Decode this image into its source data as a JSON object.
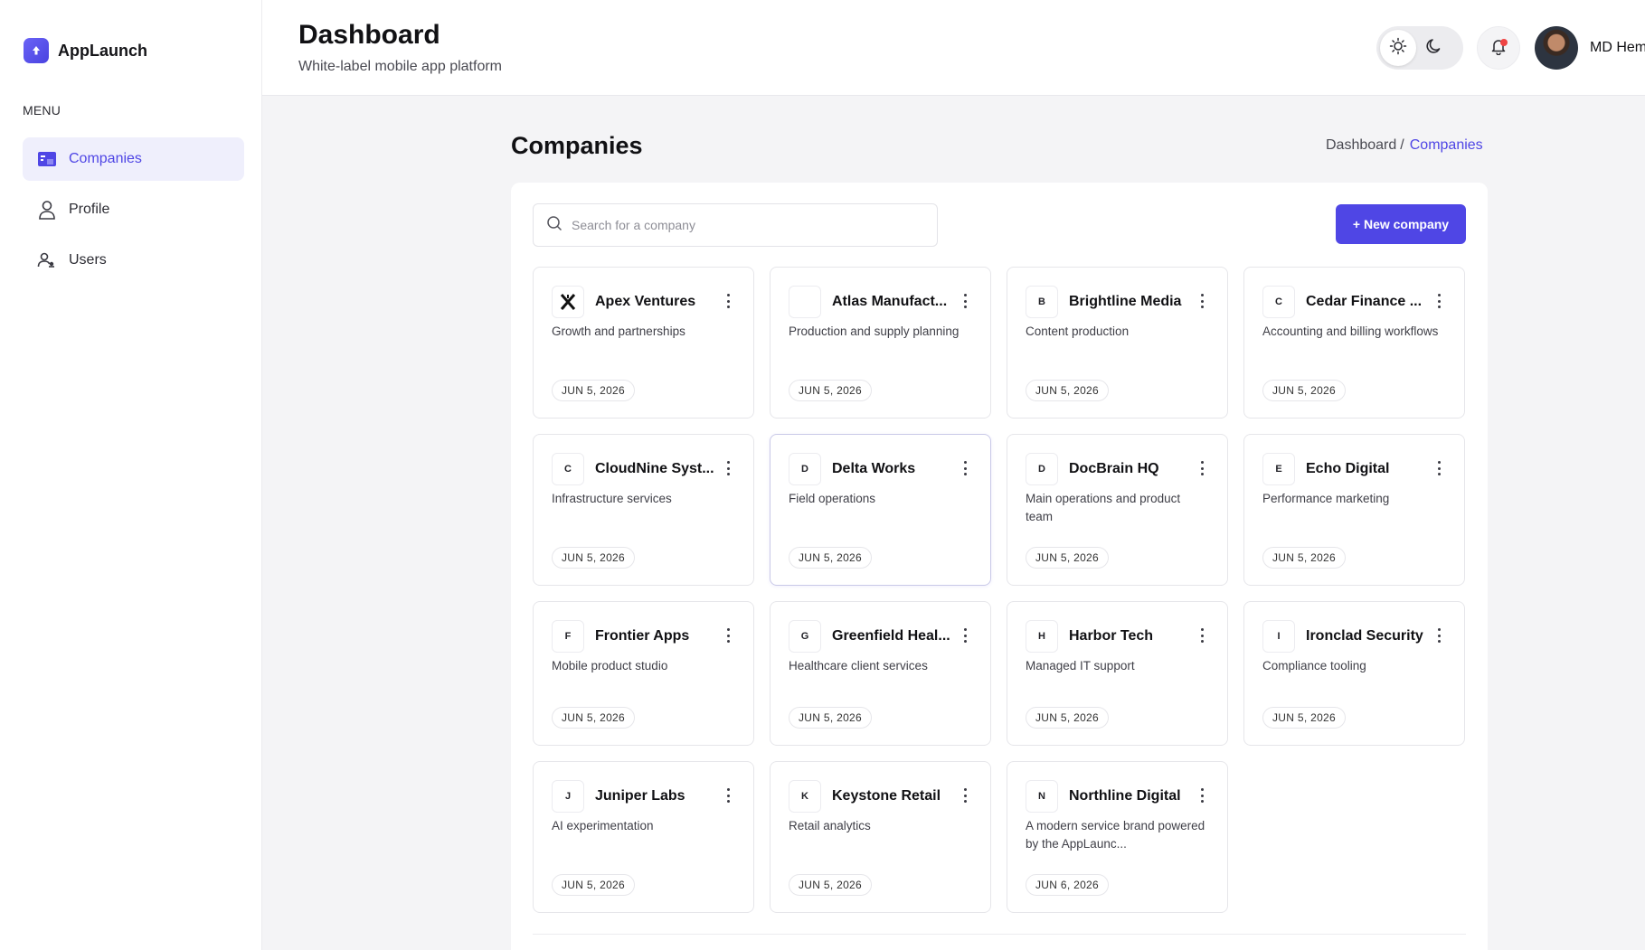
{
  "app": {
    "name": "AppLaunch",
    "brand_color": "#4f46e5"
  },
  "sidebar": {
    "menu_title": "MENU",
    "items": [
      {
        "label": "Companies",
        "icon": "companies-icon",
        "active": true
      },
      {
        "label": "Profile",
        "icon": "user-icon",
        "active": false
      },
      {
        "label": "Users",
        "icon": "users-icon",
        "active": false
      }
    ]
  },
  "header": {
    "title": "Dashboard",
    "subtitle": "White-label mobile app platform",
    "theme_options": [
      "light",
      "dark"
    ],
    "user_name": "MD Hem"
  },
  "main": {
    "title": "Companies",
    "breadcrumb": {
      "home": "Dashboard",
      "separator": "/",
      "current": "Companies"
    },
    "search": {
      "placeholder": "Search for a company",
      "value": ""
    },
    "new_button": "+ New company",
    "companies": [
      {
        "name": "Apex Ventures",
        "initial": "",
        "logo": "apex-logo",
        "description": "Growth and partnerships",
        "date": "JUN 5, 2026"
      },
      {
        "name": "Atlas Manufact...",
        "initial": "",
        "logo": "blank-logo",
        "description": "Production and supply planning",
        "date": "JUN 5, 2026"
      },
      {
        "name": "Brightline Media",
        "initial": "B",
        "description": "Content production",
        "date": "JUN 5, 2026"
      },
      {
        "name": "Cedar Finance ...",
        "initial": "C",
        "description": "Accounting and billing workflows",
        "date": "JUN 5, 2026"
      },
      {
        "name": "CloudNine Syst...",
        "initial": "C",
        "description": "Infrastructure services",
        "date": "JUN 5, 2026"
      },
      {
        "name": "Delta Works",
        "initial": "D",
        "description": "Field operations",
        "date": "JUN 5, 2026"
      },
      {
        "name": "DocBrain HQ",
        "initial": "D",
        "description": "Main operations and product team",
        "date": "JUN 5, 2026"
      },
      {
        "name": "Echo Digital",
        "initial": "E",
        "description": "Performance marketing",
        "date": "JUN 5, 2026"
      },
      {
        "name": "Frontier Apps",
        "initial": "F",
        "description": "Mobile product studio",
        "date": "JUN 5, 2026"
      },
      {
        "name": "Greenfield Heal...",
        "initial": "G",
        "description": "Healthcare client services",
        "date": "JUN 5, 2026"
      },
      {
        "name": "Harbor Tech",
        "initial": "H",
        "description": "Managed IT support",
        "date": "JUN 5, 2026"
      },
      {
        "name": "Ironclad Security",
        "initial": "I",
        "description": "Compliance tooling",
        "date": "JUN 5, 2026"
      },
      {
        "name": "Juniper Labs",
        "initial": "J",
        "description": "AI experimentation",
        "date": "JUN 5, 2026"
      },
      {
        "name": "Keystone Retail",
        "initial": "K",
        "description": "Retail analytics",
        "date": "JUN 5, 2026"
      },
      {
        "name": "Northline Digital",
        "initial": "N",
        "description": "A modern service brand powered by the AppLaunc...",
        "date": "JUN 6, 2026"
      }
    ]
  }
}
